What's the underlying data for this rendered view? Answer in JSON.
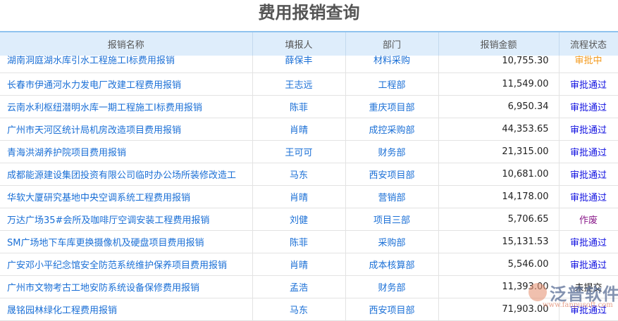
{
  "title": "费用报销查询",
  "columns": [
    "报销名称",
    "填报人",
    "部门",
    "报销金额",
    "流程状态"
  ],
  "colors": {
    "审批中": "#f39a1e",
    "审批通过": "#1010e0",
    "作废": "#8a1a8a",
    "未提交": "#222222"
  },
  "rows": [
    [
      "湖南洞庭湖水库引水工程施工I标费用报销",
      "薛保丰",
      "材料采购",
      "10,755.30",
      "审批中"
    ],
    [
      "长春市伊通河水力发电厂改建工程费用报销",
      "王志远",
      "工程部",
      "11,549.00",
      "审批通过"
    ],
    [
      "云南水利枢纽潜明水库一期工程施工I标费用报销",
      "陈菲",
      "重庆项目部",
      "6,950.34",
      "审批通过"
    ],
    [
      "广州市天河区统计局机房改造项目费用报销",
      "肖晴",
      "成控采购部",
      "44,353.65",
      "审批通过"
    ],
    [
      "青海洪湖养护院项目费用报销",
      "王可可",
      "财务部",
      "21,315.00",
      "审批通过"
    ],
    [
      "成都能源建设集团投资有限公司临时办公场所装修改造工",
      "马东",
      "西安项目部",
      "10,681.00",
      "审批通过"
    ],
    [
      "华软大厦研究基地中央空调系统工程费用报销",
      "肖晴",
      "营销部",
      "14,178.00",
      "审批通过"
    ],
    [
      "万达广场35#会所及咖啡厅空调安装工程费用报销",
      "刘健",
      "项目三部",
      "5,706.65",
      "作废"
    ],
    [
      "SM广场地下车库更换摄像机及硬盘项目费用报销",
      "陈菲",
      "采购部",
      "15,131.53",
      "审批通过"
    ],
    [
      "广安邓小平纪念馆安全防范系统维护保养项目费用报销",
      "肖晴",
      "成本核算部",
      "5,546.00",
      "审批通过"
    ],
    [
      "广州市文物考古工地安防系统设备保修费用报销",
      "孟浩",
      "财务部",
      "11,393.00",
      "未提交"
    ],
    [
      "晟铭园林绿化工程费用报销",
      "马东",
      "西安项目部",
      "71,903.00",
      "审批通过"
    ]
  ],
  "watermark": {
    "brand": "泛普软件",
    "url": "www.fanpusoft.com"
  }
}
